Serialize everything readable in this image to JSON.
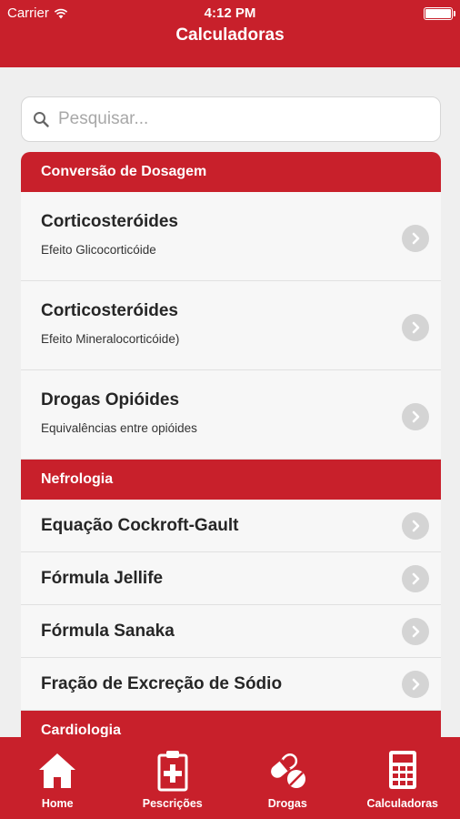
{
  "status_bar": {
    "carrier": "Carrier",
    "time": "4:12 PM"
  },
  "header": {
    "title": "Calculadoras"
  },
  "search": {
    "placeholder": "Pesquisar..."
  },
  "sections": [
    {
      "title": "Conversão de Dosagem",
      "rows": [
        {
          "title": "Corticosteróides",
          "subtitle": "Efeito Glicocorticóide"
        },
        {
          "title": "Corticosteróides",
          "subtitle": "Efeito Mineralocorticóide)"
        },
        {
          "title": "Drogas Opióides",
          "subtitle": "Equivalências entre opióides"
        }
      ]
    },
    {
      "title": "Nefrologia",
      "rows": [
        {
          "title": "Equação Cockroft-Gault"
        },
        {
          "title": "Fórmula Jellife"
        },
        {
          "title": "Fórmula Sanaka"
        },
        {
          "title": "Fração de Excreção de Sódio"
        }
      ]
    },
    {
      "title": "Cardiologia",
      "rows": []
    }
  ],
  "tabbar": {
    "items": [
      {
        "label": "Home",
        "icon": "home-icon"
      },
      {
        "label": "Pescrições",
        "icon": "prescription-icon"
      },
      {
        "label": "Drogas",
        "icon": "pills-icon"
      },
      {
        "label": "Calculadoras",
        "icon": "calculator-icon"
      }
    ]
  },
  "colors": {
    "brand": "#c8202b",
    "background": "#efefef",
    "row": "#f7f7f7",
    "chevron": "#d4d4d4"
  }
}
